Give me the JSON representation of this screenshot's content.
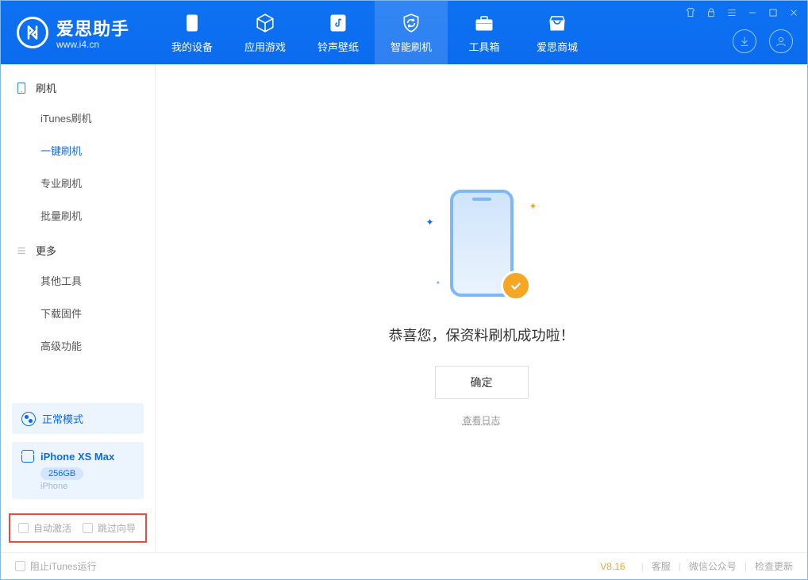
{
  "app": {
    "name": "爱思助手",
    "url": "www.i4.cn"
  },
  "tabs": {
    "device": "我的设备",
    "apps": "应用游戏",
    "ringtones": "铃声壁纸",
    "flash": "智能刷机",
    "toolbox": "工具箱",
    "store": "爱思商城"
  },
  "sidebar": {
    "group_flash": "刷机",
    "items_flash": {
      "itunes": "iTunes刷机",
      "onekey": "一键刷机",
      "pro": "专业刷机",
      "batch": "批量刷机"
    },
    "group_more": "更多",
    "items_more": {
      "other": "其他工具",
      "firmware": "下载固件",
      "advanced": "高级功能"
    },
    "mode": "正常模式",
    "device_name": "iPhone XS Max",
    "device_cap": "256GB",
    "device_type": "iPhone",
    "opt_activate": "自动激活",
    "opt_skip": "跳过向导"
  },
  "main": {
    "success": "恭喜您，保资料刷机成功啦！",
    "confirm": "确定",
    "log": "查看日志"
  },
  "footer": {
    "block_itunes": "阻止iTunes运行",
    "version": "V8.16",
    "cs": "客服",
    "wechat": "微信公众号",
    "update": "检查更新"
  }
}
